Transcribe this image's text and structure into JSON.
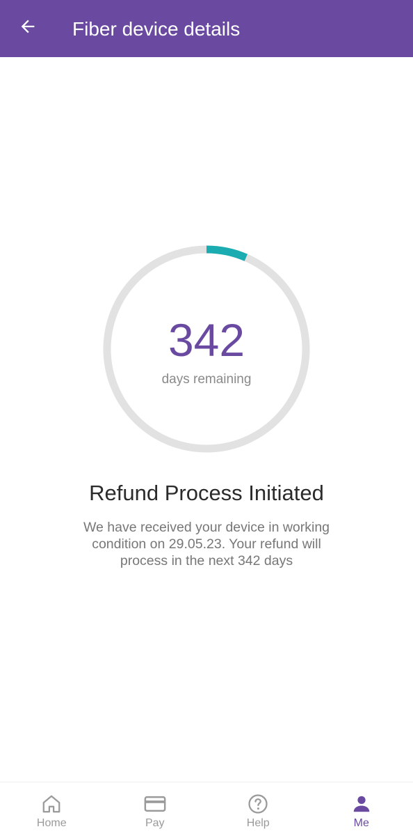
{
  "header": {
    "title": "Fiber device details",
    "back_icon": "arrow-left-icon",
    "background_color": "#6a4aa0"
  },
  "countdown": {
    "value": "342",
    "label": "days remaining",
    "progress_fraction": 0.065,
    "track_color": "#e2e2e2",
    "progress_color": "#1aacb0"
  },
  "status": {
    "title": "Refund Process Initiated",
    "description": "We have received your device in working condition on 29.05.23. Your refund will process in the next 342 days"
  },
  "bottom_nav": {
    "active": "Me",
    "active_color": "#6a4aa0",
    "items": [
      {
        "label": "Home",
        "icon": "home-icon"
      },
      {
        "label": "Pay",
        "icon": "credit-card-icon"
      },
      {
        "label": "Help",
        "icon": "help-circle-icon"
      },
      {
        "label": "Me",
        "icon": "person-icon"
      }
    ]
  }
}
